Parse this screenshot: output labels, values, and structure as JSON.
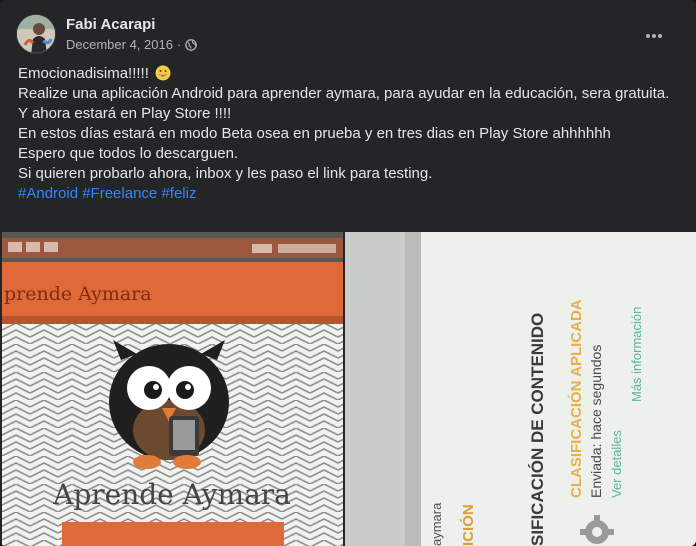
{
  "post": {
    "author": "Fabi Acarapi",
    "date": "December 4, 2016",
    "separator": "·",
    "privacy_icon": "globe-icon",
    "more_icon": "more-horizontal-icon",
    "lines": [
      "Emocionadisima!!!!!",
      "Realize una aplicación Android para aprender aymara, para ayudar en la educación, sera gratuita.",
      "Y ahora estará en Play Store !!!!",
      "En estos días estará en modo Beta osea en prueba y en tres dias en Play Store ahhhhhh",
      "Espero que todos lo descarguen.",
      "Si quieren probarlo ahora, inbox y les paso el link para testing."
    ],
    "emoji_icon": "grinning-face-icon",
    "hashtags": [
      "#Android",
      "#Freelance",
      "#feliz"
    ]
  },
  "photos": {
    "left": {
      "app_bar_title": "prende Aymara",
      "logo_text": "Aprende Aymara"
    },
    "right": {
      "heading": "SIFICACIÓN DE CONTENIDO",
      "classification": "CLASIFICACIÓN APLICADA",
      "sent": "Enviada: hace segundos",
      "details_link": "Ver detalles",
      "more_info_link": "Más información",
      "edge_text_1": "aymara",
      "edge_text_2": "ICIÓN"
    }
  },
  "colors": {
    "card_bg": "#242526",
    "text_primary": "#e4e6eb",
    "text_secondary": "#b0b3b8",
    "link": "#2d88ff",
    "app_orange": "#e0693a",
    "classification_orange": "#e8b04a",
    "link_green": "#58b79a"
  }
}
